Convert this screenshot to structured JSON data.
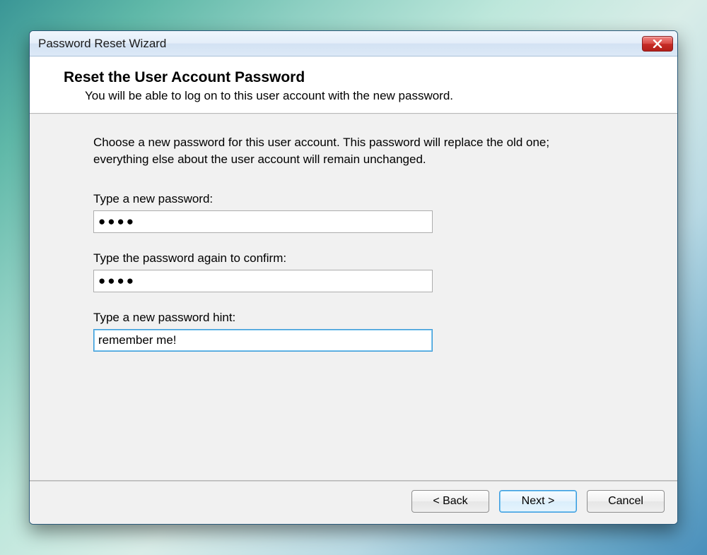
{
  "window": {
    "title": "Password Reset Wizard"
  },
  "header": {
    "heading": "Reset the User Account Password",
    "subtitle": "You will be able to log on to this user account with the new password."
  },
  "content": {
    "instructions": "Choose a new password for this user account. This password will replace the old one; everything else about the user account will remain unchanged.",
    "fields": {
      "new_password": {
        "label": "Type a new password:",
        "value": "●●●●"
      },
      "confirm_password": {
        "label": "Type the password again to confirm:",
        "value": "●●●●"
      },
      "hint": {
        "label": "Type a new password hint:",
        "value": "remember me!"
      }
    }
  },
  "buttons": {
    "back": "< Back",
    "next": "Next >",
    "cancel": "Cancel"
  }
}
